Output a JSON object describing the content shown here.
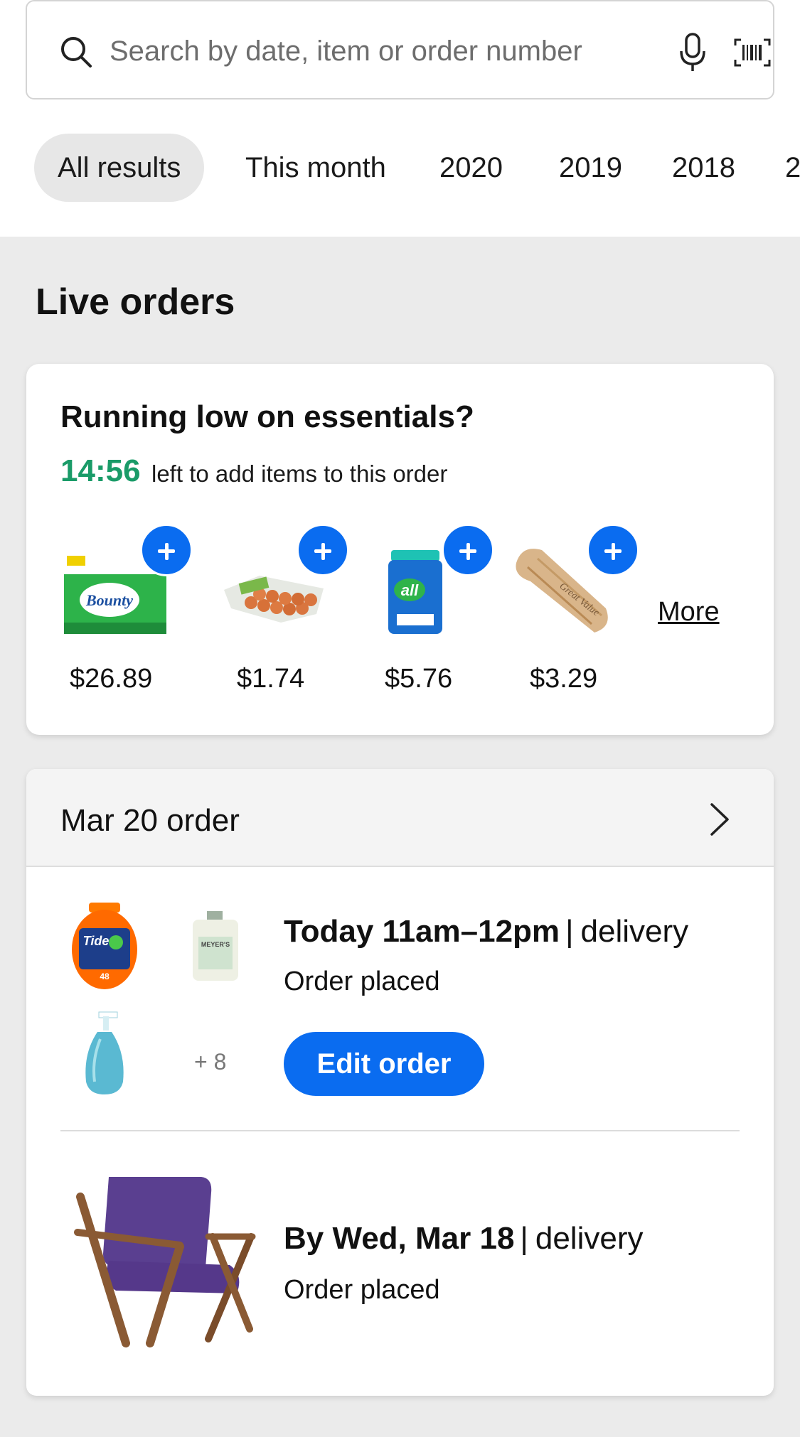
{
  "search": {
    "placeholder": "Search by date, item or order number",
    "icons": [
      "search-icon",
      "microphone-icon",
      "barcode-icon"
    ]
  },
  "filters": [
    {
      "label": "All results",
      "active": true
    },
    {
      "label": "This month",
      "active": false
    },
    {
      "label": "2020",
      "active": false
    },
    {
      "label": "2019",
      "active": false
    },
    {
      "label": "2018",
      "active": false
    },
    {
      "label": "2",
      "active": false
    }
  ],
  "live_orders": {
    "heading": "Live orders"
  },
  "essentials": {
    "title": "Running low on essentials?",
    "timer": "14:56",
    "timer_note": "left to add items to this order",
    "items": [
      {
        "name": "paper-towels",
        "price": "$26.89"
      },
      {
        "name": "eggs",
        "price": "$1.74"
      },
      {
        "name": "laundry-detergent",
        "price": "$5.76"
      },
      {
        "name": "bread",
        "price": "$3.29"
      }
    ],
    "more_label": "More"
  },
  "order": {
    "header": "Mar 20 order",
    "groceries": {
      "slot_bold": "Today 11am–12pm",
      "slot_sep": "|",
      "slot_rest": "delivery",
      "status": "Order placed",
      "extra_count": "+ 8",
      "edit_label": "Edit order"
    },
    "furniture": {
      "slot_bold": "By Wed, Mar 18",
      "slot_sep": "|",
      "slot_rest": "delivery",
      "status": "Order placed"
    }
  },
  "colors": {
    "accent_blue": "#0a6cf0",
    "timer_green": "#1a9b68",
    "background": "#ebebeb"
  }
}
